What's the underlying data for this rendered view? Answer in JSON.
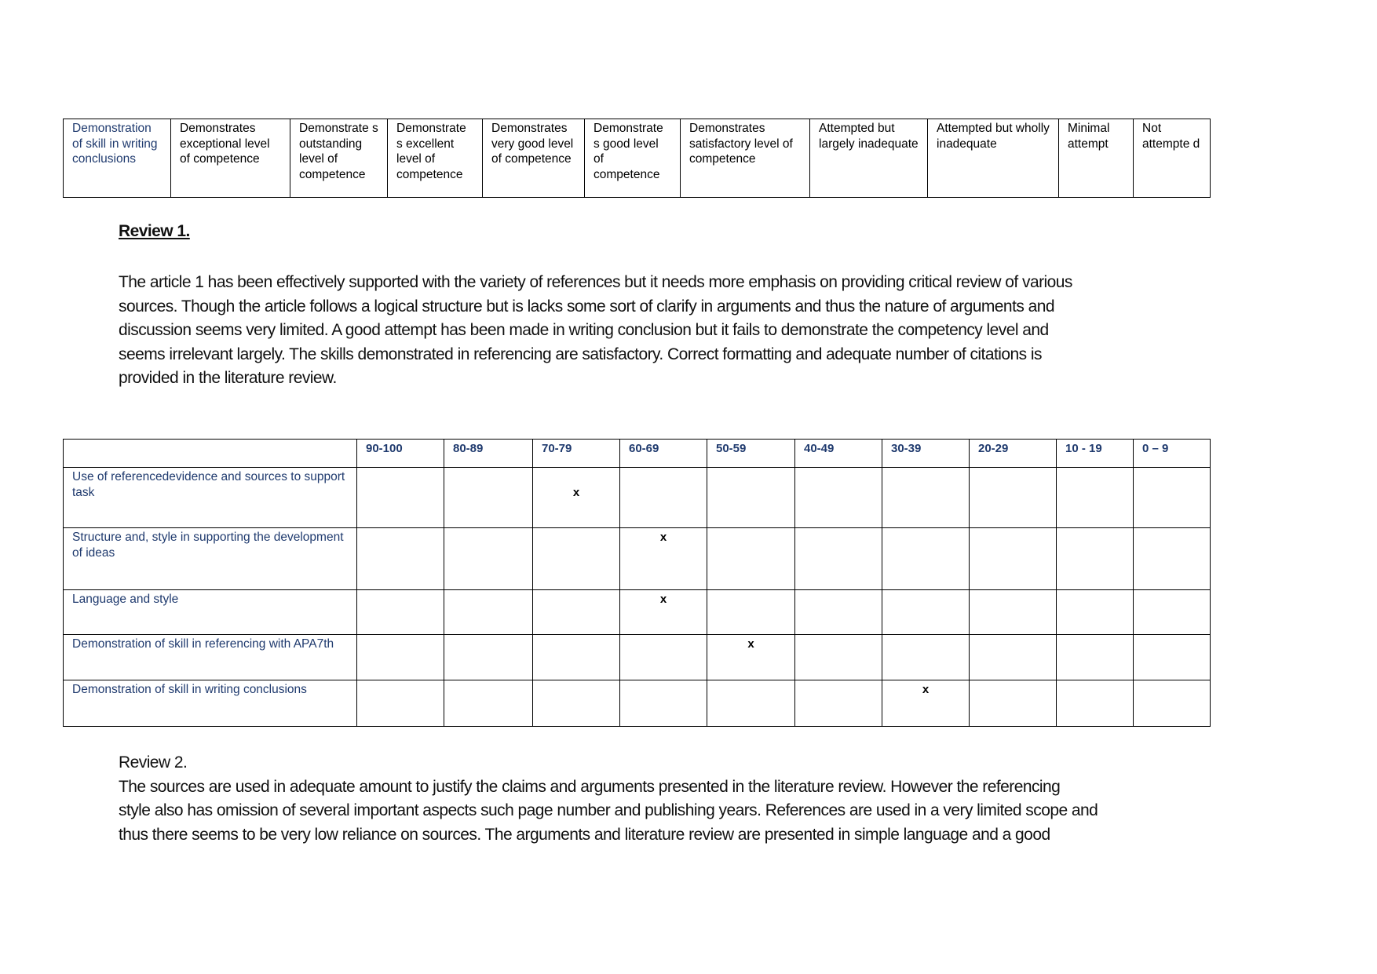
{
  "table1": {
    "cells": [
      "Demonstration of skill in writing conclusions",
      "Demonstrates exceptional level of competence",
      "Demonstrate s outstanding level of competence",
      "Demonstrate s excellent level of competence",
      "Demonstrates very good level of competence",
      "Demonstrate s good level of competence",
      "Demonstrates satisfactory level of competence",
      "Attempted but largely inadequate",
      "Attempted but wholly inadequate",
      "Minimal attempt",
      "Not attempte d"
    ]
  },
  "review1": {
    "title": "Review 1.",
    "lines": [
      "The article 1 has been effectively supported with the variety of references but it needs more emphasis on providing critical review of various",
      "sources. Though the article follows a logical structure but is lacks some sort of clarify in arguments and thus the nature of arguments and",
      "discussion seems very limited. A good attempt has been made in writing conclusion but it fails to demonstrate the competency level and",
      "seems irrelevant largely. The skills demonstrated in referencing are satisfactory. Correct formatting and adequate number of citations is",
      "provided in the literature review."
    ]
  },
  "table2": {
    "columns": [
      "90-100",
      "80-89",
      "70-79",
      "60-69",
      "50-59",
      "40-49",
      "30-39",
      "20-29",
      "10 - 19",
      "0 – 9"
    ],
    "mark_symbol": "x",
    "rows": [
      {
        "criterion": "Use of referencedevidence and sources to support task",
        "mark": "70-79"
      },
      {
        "criterion": "Structure and, style in supporting the development of ideas",
        "mark": "60-69"
      },
      {
        "criterion": "Language and style",
        "mark": "60-69"
      },
      {
        "criterion": "Demonstration of skill in referencing with APA7th",
        "mark": "50-59"
      },
      {
        "criterion": "Demonstration of skill in writing conclusions",
        "mark": "30-39"
      }
    ]
  },
  "review2": {
    "lines": [
      "Review 2.",
      "The sources are used in adequate amount to justify the claims and arguments presented in the literature review. However the referencing",
      "style also has omission of several important aspects such page number and publishing years. References are used in a very limited scope and",
      "thus there seems to be very low reliance on sources. The arguments and literature review are presented in simple language and a good"
    ]
  },
  "colors": {
    "criteria_text": "#1f3a6e",
    "body_text": "#111111"
  }
}
